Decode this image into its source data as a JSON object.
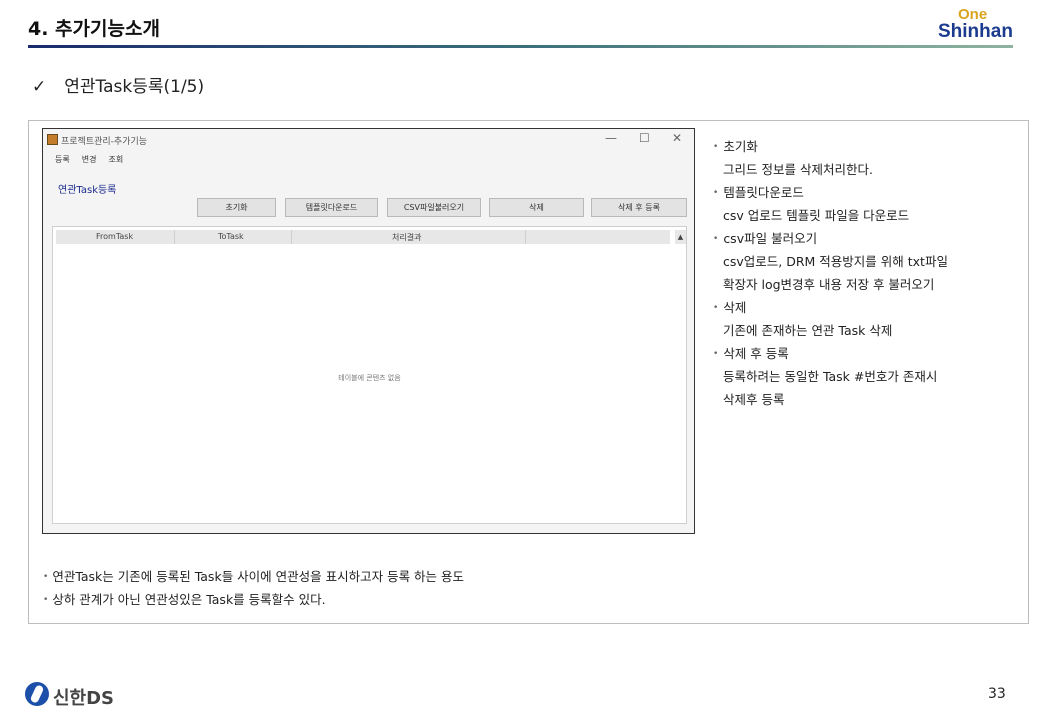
{
  "header": {
    "title": "4. 추가기능소개",
    "logo_top": "One",
    "logo_bottom": "Shinhan"
  },
  "subtitle": {
    "check": "✓",
    "text": "연관Task등록(1/5)"
  },
  "app": {
    "window_title": "프로젝트관리-추가기능",
    "controls": [
      "—",
      "☐",
      "✕"
    ],
    "menu": [
      "등록",
      "변경",
      "조회"
    ],
    "heading": "연관Task등록",
    "buttons": [
      "초기화",
      "템플릿다운로드",
      "CSV파일불러오기",
      "삭제",
      "삭제 후 등록"
    ],
    "grid": {
      "columns": [
        "FromTask",
        "ToTask",
        "처리결과"
      ],
      "scroll_symbol": "▲",
      "empty_text": "테이블에 콘텐츠 없음"
    }
  },
  "notes": [
    {
      "title": "초기화",
      "lines": [
        "그리드 정보를 삭제처리한다."
      ]
    },
    {
      "title": "템플릿다운로드",
      "lines": [
        "csv 업로드 템플릿 파일을 다운로드"
      ]
    },
    {
      "title": "csv파일 불러오기",
      "lines": [
        "csv업로드, DRM 적용방지를 위해 txt파일",
        "확장자 log변경후 내용 저장 후 불러오기"
      ]
    },
    {
      "title": "삭제",
      "lines": [
        "기존에 존재하는 연관 Task 삭제"
      ]
    },
    {
      "title": "삭제 후 등록",
      "lines": [
        "등록하려는 동일한 Task #번호가 존재시",
        "삭제후 등록"
      ]
    }
  ],
  "bullet_symbol": "•",
  "bottom_notes": [
    "연관Task는 기존에 등록된 Task들 사이에 연관성을 표시하고자 등록 하는 용도",
    "상하 관계가 아닌 연관성있은 Task를 등록할수 있다."
  ],
  "footer": {
    "brand": "신한DS",
    "page_number": "33"
  }
}
